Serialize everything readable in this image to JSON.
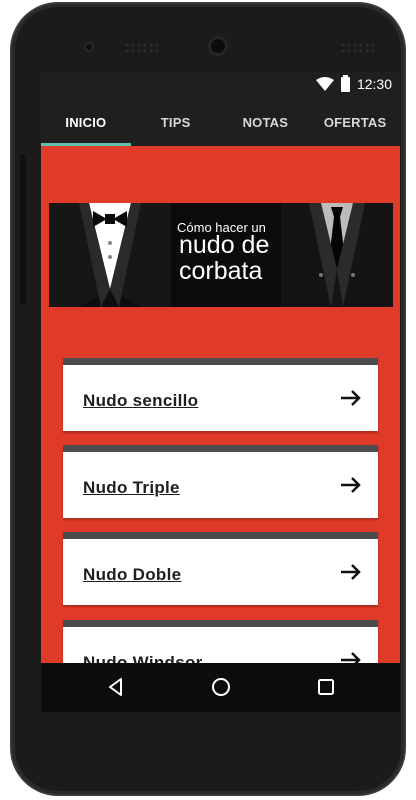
{
  "status_bar": {
    "time": "12:30",
    "icons": [
      "wifi-icon",
      "battery-icon"
    ]
  },
  "tabs": [
    {
      "label": "INICIO",
      "active": true
    },
    {
      "label": "TIPS",
      "active": false
    },
    {
      "label": "NOTAS",
      "active": false
    },
    {
      "label": "OFERTAS",
      "active": false
    }
  ],
  "banner": {
    "line1": "Cómo hacer un",
    "line2": "nudo de",
    "line3": "corbata"
  },
  "items": [
    {
      "label": "Nudo sencillo",
      "icon": "arrow-right-icon"
    },
    {
      "label": "Nudo Triple",
      "icon": "arrow-right-icon"
    },
    {
      "label": "Nudo Doble",
      "icon": "arrow-right-icon"
    },
    {
      "label": "Nudo Windsor",
      "icon": "arrow-right-icon"
    }
  ],
  "navigation": [
    "back-icon",
    "home-icon",
    "recents-icon"
  ],
  "colors": {
    "background": "#e03a28",
    "bar": "#1f1f1f",
    "tab_indicator": "#5fc2b0",
    "card": "#ffffff",
    "card_border": "#4c4c4c"
  }
}
